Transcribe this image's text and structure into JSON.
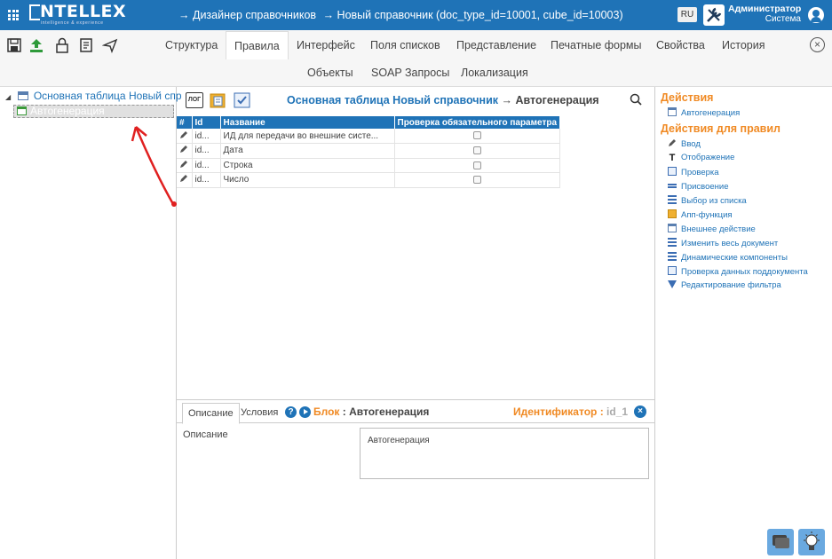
{
  "header": {
    "logo_text": "NTELLEX",
    "logo_tagline": "intelligence & experience",
    "breadcrumb": [
      "→ Дизайнер справочников",
      "→ Новый справочник (doc_type_id=10001, cube_id=10003)"
    ],
    "language": "RU",
    "user_name": "Администратор",
    "user_role": "Система"
  },
  "tabs": {
    "row1": [
      "Структура",
      "Правила",
      "Интерфейс",
      "Поля списков",
      "Представление",
      "Печатные формы",
      "Свойства",
      "История"
    ],
    "row2": [
      "Объекты",
      "SOAP Запросы",
      "Локализация"
    ],
    "active": "Правила"
  },
  "tree": {
    "root_label": "Основная таблица Новый спр",
    "child_label": "Автогенерация"
  },
  "center": {
    "log_label": "ЛОГ",
    "title_main": "Основная таблица Новый справочник",
    "title_sep": " → ",
    "title_sub": "Автогенерация",
    "columns": [
      "#",
      "Id",
      "Название",
      "Проверка обязательного параметра"
    ],
    "rows": [
      {
        "id": "id...",
        "name": "ИД для передачи во внешние систе...",
        "checked": false
      },
      {
        "id": "id...",
        "name": "Дата",
        "checked": false
      },
      {
        "id": "id...",
        "name": "Строка",
        "checked": false
      },
      {
        "id": "id...",
        "name": "Число",
        "checked": false
      }
    ]
  },
  "bottom": {
    "tab_description": "Описание",
    "tab_conditions": "Условия",
    "help": "?",
    "block_label": "Блок",
    "block_value": "Автогенерация",
    "ident_label": "Идентификатор",
    "ident_value": "id_1",
    "close": "×",
    "desc_label": "Описание",
    "desc_value": "Автогенерация"
  },
  "right": {
    "actions_title": "Действия",
    "actions": [
      {
        "label": "Автогенерация",
        "icon": "table-icon"
      }
    ],
    "rule_actions_title": "Действия для правил",
    "rule_actions": [
      {
        "label": "Ввод",
        "icon": "pencil-icon"
      },
      {
        "label": "Отображение",
        "icon": "text-icon"
      },
      {
        "label": "Проверка",
        "icon": "check-icon"
      },
      {
        "label": "Присвоение",
        "icon": "equals-icon"
      },
      {
        "label": "Выбор из списка",
        "icon": "list-icon"
      },
      {
        "label": "Апп-функция",
        "icon": "app-function-icon"
      },
      {
        "label": "Внешнее действие",
        "icon": "external-action-icon"
      },
      {
        "label": "Изменить весь документ",
        "icon": "document-icon"
      },
      {
        "label": "Динамические компоненты",
        "icon": "components-icon"
      },
      {
        "label": "Проверка данных поддокумента",
        "icon": "subdocument-check-icon"
      },
      {
        "label": "Редактирование фильтра",
        "icon": "filter-icon"
      }
    ]
  },
  "colors": {
    "brand_blue": "#1f73b7",
    "accent_orange": "#f08a24",
    "annotation_red": "#e02020"
  }
}
